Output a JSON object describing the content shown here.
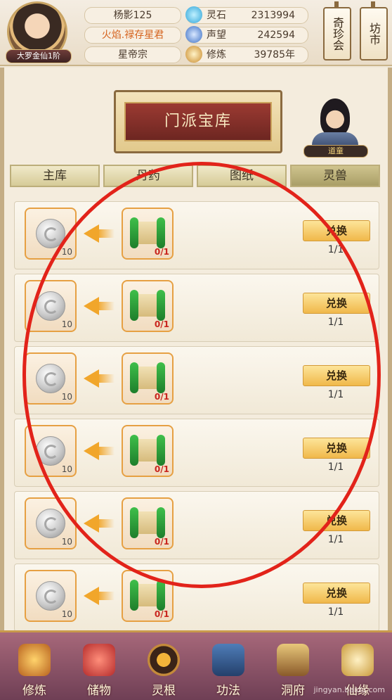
{
  "header": {
    "player_name": "杨影125",
    "title": "火焰.禄存星君",
    "sect": "星帝宗",
    "rank": "大罗金仙1阶",
    "resources": [
      {
        "icon": "spirit-stone-icon",
        "name": "灵石",
        "value": "2313994"
      },
      {
        "icon": "reputation-icon",
        "name": "声望",
        "value": "242594"
      },
      {
        "icon": "cultivation-icon",
        "name": "修炼",
        "value": "39785年"
      }
    ],
    "side_buttons": [
      "奇珍会",
      "坊市"
    ]
  },
  "panel": {
    "title": "门派宝库",
    "npc_label": "道童",
    "tabs": [
      "主库",
      "丹药",
      "图纸",
      "灵兽"
    ],
    "active_tab": 3
  },
  "rows": [
    {
      "cost": "10",
      "need": "0/1",
      "button": "兑换",
      "limit": "1/1"
    },
    {
      "cost": "10",
      "need": "0/1",
      "button": "兑换",
      "limit": "1/1"
    },
    {
      "cost": "10",
      "need": "0/1",
      "button": "兑换",
      "limit": "1/1"
    },
    {
      "cost": "10",
      "need": "0/1",
      "button": "兑换",
      "limit": "1/1"
    },
    {
      "cost": "10",
      "need": "0/1",
      "button": "兑换",
      "limit": "1/1"
    },
    {
      "cost": "10",
      "need": "0/1",
      "button": "兑换",
      "limit": "1/1"
    }
  ],
  "bottom_nav": [
    {
      "label": "修炼",
      "icon": "meditating-figure-icon"
    },
    {
      "label": "储物",
      "icon": "storage-bag-icon"
    },
    {
      "label": "灵根",
      "icon": "spirit-root-icon"
    },
    {
      "label": "功法",
      "icon": "manual-book-icon"
    },
    {
      "label": "洞府",
      "icon": "cave-dwelling-icon"
    },
    {
      "label": "仙缘",
      "icon": "fate-icon"
    }
  ],
  "watermark": "jingyan.baidu.com",
  "colors": {
    "accent": "#e2a043",
    "annotation": "#e2231a",
    "nav_bg": "#8b5068"
  }
}
